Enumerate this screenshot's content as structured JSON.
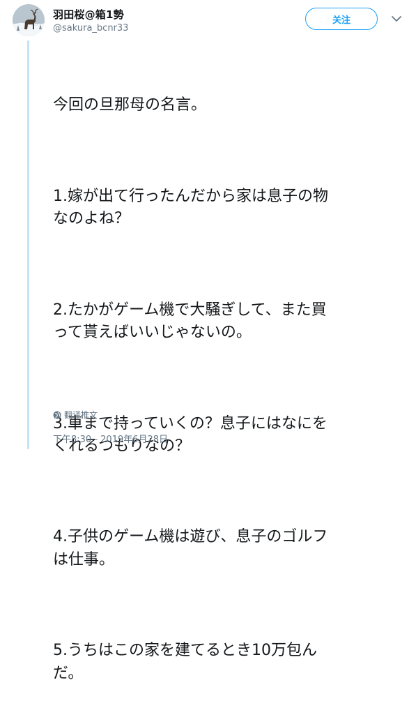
{
  "user": {
    "display_name": "羽田桜@箱1勢",
    "handle": "@sakura_bcnr33"
  },
  "follow_button": {
    "label": "关注"
  },
  "tweet": {
    "paragraphs": [
      "今回の旦那母の名言。",
      "1.嫁が出て行ったんだから家は息子の物\nなのよね？",
      "2.たかがゲーム機で大騒ぎして、また買\nって貰えばいいじゃないの。",
      "3.車まで持っていくの？息子にはなにを\nくれるつもりなの？",
      "4.子供のゲーム機は遊び、息子のゴルフ\nは仕事。",
      "5.うちはこの家を建てるとき10万包ん\nだ。"
    ],
    "translate_label": "翻译推文",
    "timestamp": "下午8:30 - 2019年6月28日"
  },
  "colors": {
    "accent": "#1da1f2",
    "thread_line": "#c4e3f7",
    "secondary_text": "#657786"
  },
  "icons": {
    "caret": "chevron-down-icon",
    "translate": "globe-icon"
  }
}
